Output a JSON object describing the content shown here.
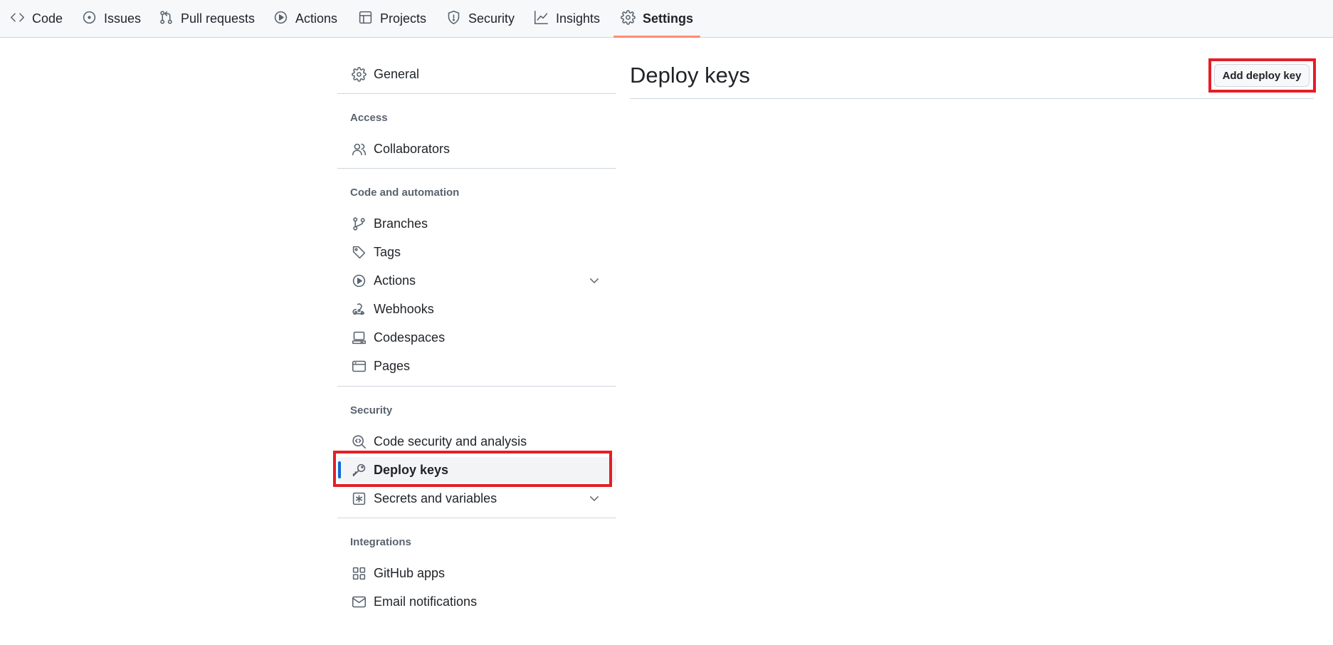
{
  "topnav": {
    "tabs": [
      {
        "label": "Code",
        "icon": "code-icon"
      },
      {
        "label": "Issues",
        "icon": "issue-opened-icon"
      },
      {
        "label": "Pull requests",
        "icon": "git-pull-request-icon"
      },
      {
        "label": "Actions",
        "icon": "play-icon"
      },
      {
        "label": "Projects",
        "icon": "table-icon"
      },
      {
        "label": "Security",
        "icon": "shield-icon"
      },
      {
        "label": "Insights",
        "icon": "graph-icon"
      },
      {
        "label": "Settings",
        "icon": "gear-icon",
        "active": true
      }
    ]
  },
  "sidebar": {
    "general": {
      "label": "General",
      "icon": "gear-icon"
    },
    "sections": {
      "access": {
        "heading": "Access",
        "items": [
          {
            "label": "Collaborators",
            "icon": "people-icon"
          }
        ]
      },
      "code_automation": {
        "heading": "Code and automation",
        "items": [
          {
            "label": "Branches",
            "icon": "git-branch-icon"
          },
          {
            "label": "Tags",
            "icon": "tag-icon"
          },
          {
            "label": "Actions",
            "icon": "play-icon",
            "expandable": true
          },
          {
            "label": "Webhooks",
            "icon": "webhook-icon"
          },
          {
            "label": "Codespaces",
            "icon": "codespaces-icon"
          },
          {
            "label": "Pages",
            "icon": "browser-icon"
          }
        ]
      },
      "security": {
        "heading": "Security",
        "items": [
          {
            "label": "Code security and analysis",
            "icon": "codescan-icon"
          },
          {
            "label": "Deploy keys",
            "icon": "key-icon",
            "selected": true
          },
          {
            "label": "Secrets and variables",
            "icon": "asterisk-icon",
            "expandable": true
          }
        ]
      },
      "integrations": {
        "heading": "Integrations",
        "items": [
          {
            "label": "GitHub apps",
            "icon": "apps-icon"
          },
          {
            "label": "Email notifications",
            "icon": "mail-icon"
          }
        ]
      }
    }
  },
  "main": {
    "title": "Deploy keys",
    "add_button_label": "Add deploy key"
  },
  "colors": {
    "accent_underline": "#fd8c73",
    "selected_indicator": "#0969da",
    "highlight_box": "#e41e26"
  }
}
